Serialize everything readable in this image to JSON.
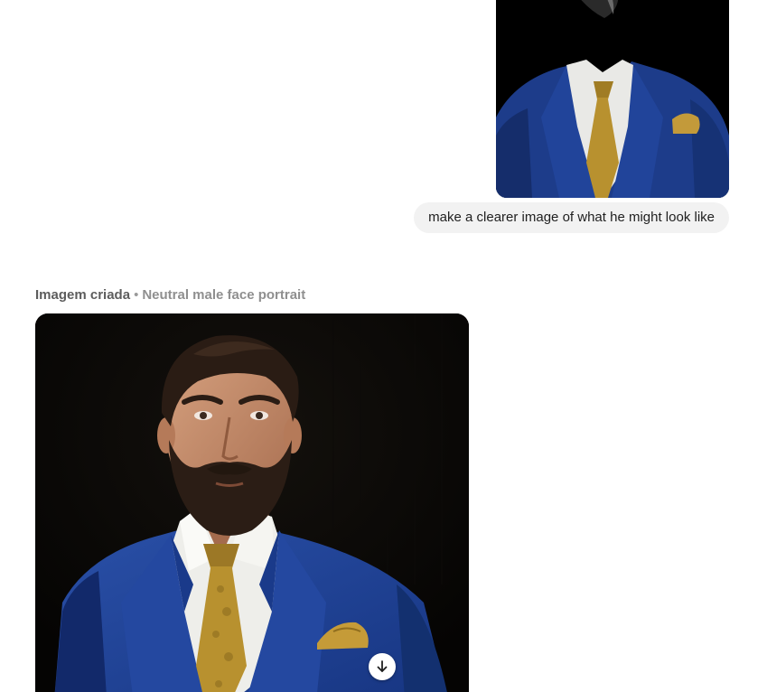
{
  "conversation": {
    "user_message": {
      "text": "make a clearer image of what he might look like"
    },
    "assistant_response": {
      "label": "Imagem criada",
      "separator": "•",
      "image_title": "Neutral male face portrait"
    }
  },
  "icons": {
    "download": "arrow-down-circle-icon"
  },
  "colors": {
    "suit_blue": "#1f3f8f",
    "tie_gold": "#b8912f",
    "bubble_bg": "#f2f2f2",
    "background": "#000000"
  }
}
